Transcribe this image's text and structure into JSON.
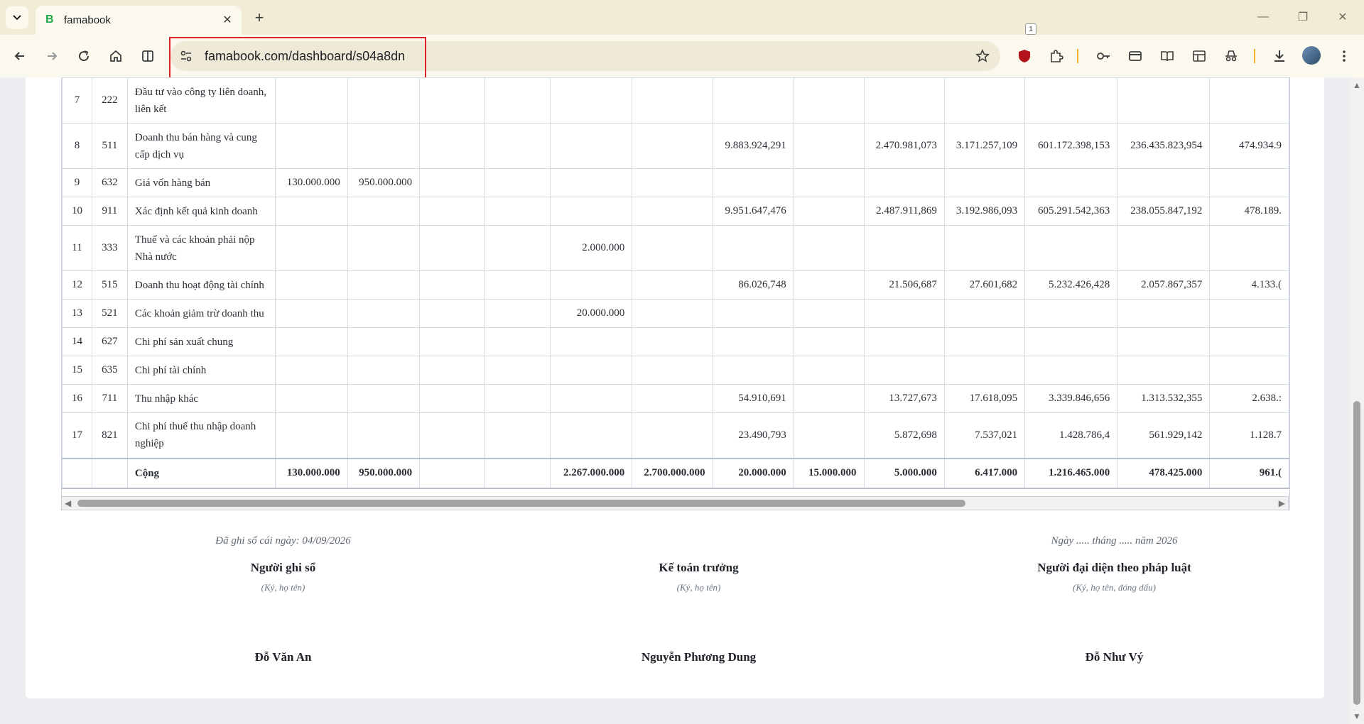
{
  "browser": {
    "tab_title": "famabook",
    "favicon_letter": "B",
    "url": "famabook.com/dashboard/s04a8dn",
    "extension_badge": "1"
  },
  "table": {
    "rows": [
      {
        "stt": "7",
        "acc": "222",
        "name": "Đầu tư vào công ty liên doanh, liên kết",
        "v": [
          "",
          "",
          "",
          "",
          "",
          "",
          "",
          "",
          "",
          "",
          "",
          "",
          ""
        ]
      },
      {
        "stt": "8",
        "acc": "511",
        "name": "Doanh thu bán hàng và cung cấp dịch vụ",
        "v": [
          "",
          "",
          "",
          "",
          "",
          "",
          "9.883.924,291",
          "",
          "2.470.981,073",
          "3.171.257,109",
          "601.172.398,153",
          "236.435.823,954",
          "474.934.9"
        ]
      },
      {
        "stt": "9",
        "acc": "632",
        "name": "Giá vốn hàng bán",
        "v": [
          "130.000.000",
          "950.000.000",
          "",
          "",
          "",
          "",
          "",
          "",
          "",
          "",
          "",
          "",
          ""
        ]
      },
      {
        "stt": "10",
        "acc": "911",
        "name": "Xác định kết quả kinh doanh",
        "v": [
          "",
          "",
          "",
          "",
          "",
          "",
          "9.951.647,476",
          "",
          "2.487.911,869",
          "3.192.986,093",
          "605.291.542,363",
          "238.055.847,192",
          "478.189."
        ]
      },
      {
        "stt": "11",
        "acc": "333",
        "name": "Thuế và các khoản phải nộp Nhà nước",
        "v": [
          "",
          "",
          "",
          "",
          "2.000.000",
          "",
          "",
          "",
          "",
          "",
          "",
          "",
          ""
        ]
      },
      {
        "stt": "12",
        "acc": "515",
        "name": "Doanh thu hoạt động tài chính",
        "v": [
          "",
          "",
          "",
          "",
          "",
          "",
          "86.026,748",
          "",
          "21.506,687",
          "27.601,682",
          "5.232.426,428",
          "2.057.867,357",
          "4.133.("
        ]
      },
      {
        "stt": "13",
        "acc": "521",
        "name": "Các khoản giảm trừ doanh thu",
        "v": [
          "",
          "",
          "",
          "",
          "20.000.000",
          "",
          "",
          "",
          "",
          "",
          "",
          "",
          ""
        ]
      },
      {
        "stt": "14",
        "acc": "627",
        "name": "Chi phí sản xuất chung",
        "v": [
          "",
          "",
          "",
          "",
          "",
          "",
          "",
          "",
          "",
          "",
          "",
          "",
          ""
        ]
      },
      {
        "stt": "15",
        "acc": "635",
        "name": "Chi phí tài chính",
        "v": [
          "",
          "",
          "",
          "",
          "",
          "",
          "",
          "",
          "",
          "",
          "",
          "",
          ""
        ]
      },
      {
        "stt": "16",
        "acc": "711",
        "name": "Thu nhập khác",
        "v": [
          "",
          "",
          "",
          "",
          "",
          "",
          "54.910,691",
          "",
          "13.727,673",
          "17.618,095",
          "3.339.846,656",
          "1.313.532,355",
          "2.638.:"
        ]
      },
      {
        "stt": "17",
        "acc": "821",
        "name": "Chi phí thuế thu nhập doanh nghiệp",
        "v": [
          "",
          "",
          "",
          "",
          "",
          "",
          "23.490,793",
          "",
          "5.872,698",
          "7.537,021",
          "1.428.786,4",
          "561.929,142",
          "1.128.7"
        ]
      }
    ],
    "total": {
      "label": "Cộng",
      "v": [
        "130.000.000",
        "950.000.000",
        "",
        "",
        "2.267.000.000",
        "2.700.000.000",
        "20.000.000",
        "15.000.000",
        "5.000.000",
        "6.417.000",
        "1.216.465.000",
        "478.425.000",
        "961.("
      ]
    }
  },
  "signatures": {
    "left": {
      "date": "Đã ghi sổ cái ngày: 04/09/2026",
      "role": "Người ghi sổ",
      "hint": "(Ký, họ tên)",
      "person": "Đỗ Văn An"
    },
    "middle": {
      "date": "",
      "role": "Kế toán trưởng",
      "hint": "(Ký, họ tên)",
      "person": "Nguyễn Phương Dung"
    },
    "right": {
      "date": "Ngày ..... tháng ..... năm 2026",
      "role": "Người đại diện theo pháp luật",
      "hint": "(Ký, họ tên, đóng dấu)",
      "person": "Đỗ Như Vý"
    }
  }
}
